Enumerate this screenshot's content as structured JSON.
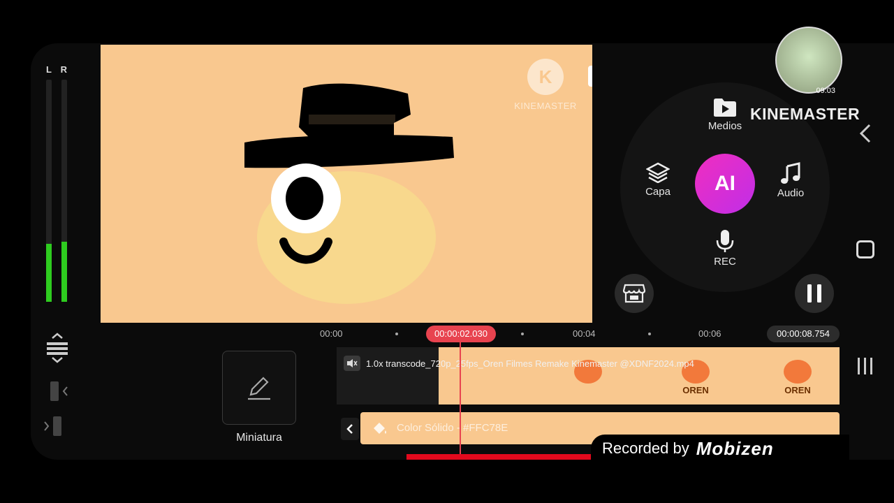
{
  "meter": {
    "left_label": "L",
    "right_label": "R",
    "left_level": 0.26,
    "right_level": 0.27
  },
  "preview": {
    "background_color": "#f9c88f",
    "watermark_logo": "K",
    "watermark_text": "KINEMASTER",
    "icons": [
      "kinemaster-logo-icon",
      "crown-icon"
    ]
  },
  "panel": {
    "medios_label": "Medios",
    "capa_label": "Capa",
    "ai_label": "AI",
    "audio_label": "Audio",
    "rec_label": "REC",
    "icons": [
      "folder-play-icon",
      "layers-icon",
      "music-note-icon",
      "microphone-icon",
      "store-icon",
      "pause-icon"
    ]
  },
  "brand": {
    "label": "KINEMASTER",
    "avatar_time": "09:03"
  },
  "timeline": {
    "ticks": [
      "00:00",
      "00:04",
      "00:06"
    ],
    "current_time": "00:00:02.030",
    "total_time": "00:00:08.754",
    "thumbnail_label": "Miniatura",
    "video_clip_name": "1.0x transcode_720p_25fps_Oren Filmes Remake Kinemaster @XDNF2024.mp4",
    "frame_labels": [
      "OREN",
      "OREN"
    ],
    "color_clip_label": "Color Sólido - #FFC78E",
    "accent_color": "#e8434f"
  },
  "recorder": {
    "text": "Recorded by",
    "brand": "Mobizen"
  }
}
